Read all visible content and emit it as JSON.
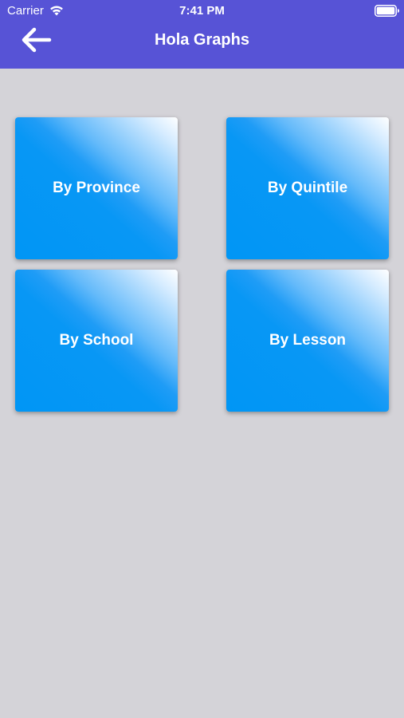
{
  "status_bar": {
    "carrier": "Carrier",
    "time": "7:41 PM",
    "wifi_icon": "wifi-icon",
    "battery_icon": "battery-icon"
  },
  "header": {
    "title": "Hola Graphs",
    "back_icon": "arrow-left-icon",
    "background_color": "#5753d6"
  },
  "tiles": [
    {
      "label": "By Province"
    },
    {
      "label": "By Quintile"
    },
    {
      "label": "By School"
    },
    {
      "label": "By Lesson"
    }
  ],
  "colors": {
    "page_background": "#d4d3d8",
    "tile_blue": "#0096f5",
    "tile_highlight": "#ffffff"
  }
}
